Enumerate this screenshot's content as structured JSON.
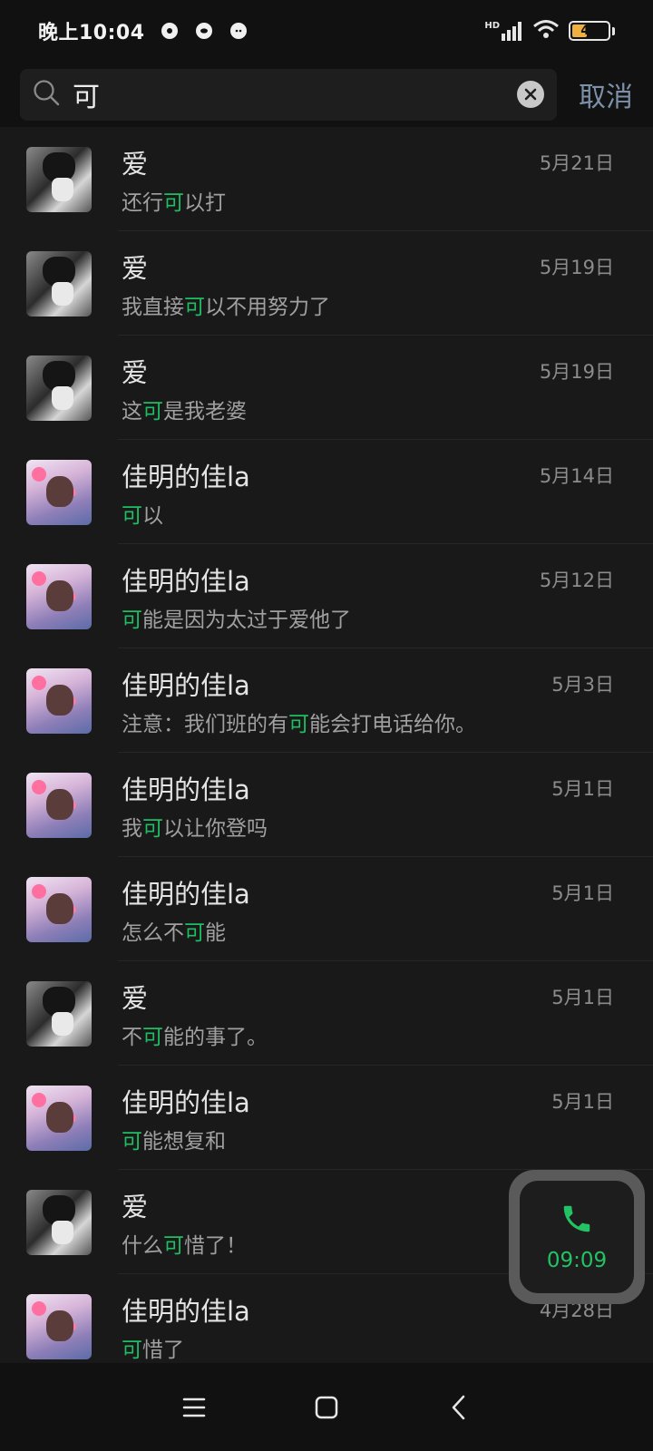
{
  "status_bar": {
    "time": "晚上10:04",
    "network": "HD",
    "battery": "43",
    "battery_level": 0.43
  },
  "search": {
    "query": "可",
    "cancel_label": "取消"
  },
  "results": [
    {
      "name": "爱",
      "avatar": "ai",
      "date": "5月21日",
      "pre": "还行",
      "hl": "可",
      "post": "以打"
    },
    {
      "name": "爱",
      "avatar": "ai",
      "date": "5月19日",
      "pre": "我直接",
      "hl": "可",
      "post": "以不用努力了"
    },
    {
      "name": "爱",
      "avatar": "ai",
      "date": "5月19日",
      "pre": "这",
      "hl": "可",
      "post": "是我老婆"
    },
    {
      "name": "佳明的佳la",
      "avatar": "jia",
      "date": "5月14日",
      "pre": "",
      "hl": "可",
      "post": "以"
    },
    {
      "name": "佳明的佳la",
      "avatar": "jia",
      "date": "5月12日",
      "pre": "",
      "hl": "可",
      "post": "能是因为太过于爱他了"
    },
    {
      "name": "佳明的佳la",
      "avatar": "jia",
      "date": "5月3日",
      "pre": "注意：我们班的有",
      "hl": "可",
      "post": "能会打电话给你。"
    },
    {
      "name": "佳明的佳la",
      "avatar": "jia",
      "date": "5月1日",
      "pre": "我",
      "hl": "可",
      "post": "以让你登吗"
    },
    {
      "name": "佳明的佳la",
      "avatar": "jia",
      "date": "5月1日",
      "pre": "怎么不",
      "hl": "可",
      "post": "能"
    },
    {
      "name": "爱",
      "avatar": "ai",
      "date": "5月1日",
      "pre": "不",
      "hl": "可",
      "post": "能的事了。"
    },
    {
      "name": "佳明的佳la",
      "avatar": "jia",
      "date": "5月1日",
      "pre": "",
      "hl": "可",
      "post": "能想复和"
    },
    {
      "name": "爱",
      "avatar": "ai",
      "date": "",
      "pre": "什么",
      "hl": "可",
      "post": "惜了！"
    },
    {
      "name": "佳明的佳la",
      "avatar": "jia",
      "date": "4月28日",
      "pre": "",
      "hl": "可",
      "post": "惜了"
    }
  ],
  "call_float": {
    "time": "09:09",
    "accent": "#23c264"
  },
  "colors": {
    "highlight": "#1fbe63",
    "cancel": "#7d90a9"
  }
}
